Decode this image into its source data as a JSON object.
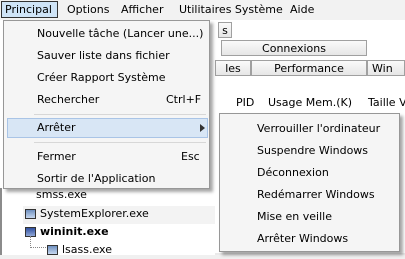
{
  "menubar": {
    "items": [
      "Principal",
      "Options",
      "Afficher",
      "Utilitaires Système",
      "Aide"
    ]
  },
  "tabs": {
    "top_partial": "s",
    "connexions": "Connexions",
    "row2_left": "les",
    "performance": "Performance",
    "row2_right": "Win"
  },
  "columns": {
    "pid": "PID",
    "usage": "Usage Mem.(K)",
    "taille": "Taille V"
  },
  "processes": [
    {
      "name": "smss.exe",
      "bold": false
    },
    {
      "name": "SystemExplorer.exe",
      "bold": false
    },
    {
      "name": "wininit.exe",
      "bold": true
    },
    {
      "name": "lsass.exe",
      "bold": false
    }
  ],
  "principal_menu": {
    "new_task": "Nouvelle tâche (Lancer une...)",
    "save_list": "Sauver liste dans fichier",
    "create_report": "Créer Rapport Système",
    "search": "Rechercher",
    "search_shortcut": "Ctrl+F",
    "stop": "Arrêter",
    "close": "Fermer",
    "close_shortcut": "Esc",
    "exit": "Sortir de l'Application"
  },
  "stop_submenu": {
    "lock": "Verrouiller l'ordinateur",
    "suspend": "Suspendre Windows",
    "logoff": "Déconnexion",
    "restart": "Redémarrer Windows",
    "sleep": "Mise en veille",
    "shutdown": "Arrêter Windows"
  },
  "icons": {
    "submenu_arrow": "chevron-right-icon",
    "process": "window-icon"
  },
  "colors": {
    "menu_highlight": "#d8e6f5",
    "menubar_active": "#cfe4f7"
  }
}
